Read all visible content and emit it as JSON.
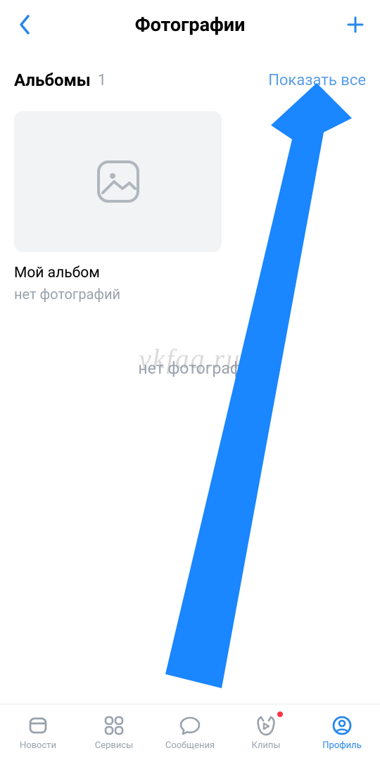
{
  "header": {
    "title": "Фотографии"
  },
  "albums_section": {
    "title": "Альбомы",
    "count": "1",
    "show_all": "Показать все",
    "items": [
      {
        "name": "Мой альбом",
        "meta": "нет фотографий"
      }
    ]
  },
  "empty_state": {
    "text": "нет фотограф"
  },
  "watermark": "vkfaq.ru",
  "tabbar": {
    "items": [
      {
        "label": "Новости"
      },
      {
        "label": "Сервисы"
      },
      {
        "label": "Сообщения"
      },
      {
        "label": "Клипы"
      },
      {
        "label": "Профиль"
      }
    ]
  },
  "colors": {
    "accent": "#2688eb",
    "link": "#5b9de8",
    "muted": "#99a2ad",
    "arrow": "#1a86ff"
  }
}
